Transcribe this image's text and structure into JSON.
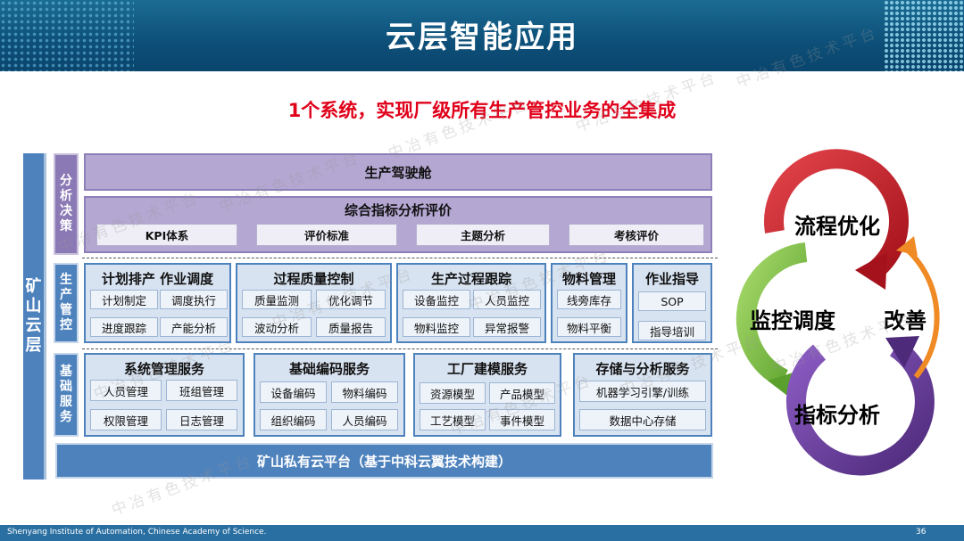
{
  "header": {
    "title": "云层智能应用"
  },
  "subtitle": "1个系统，实现厂级所有生产管控业务的全集成",
  "sidebar": {
    "label": "矿山云层"
  },
  "sections": {
    "analysis": {
      "label": "分析决策",
      "cockpit": "生产驾驶舱",
      "evaluation": {
        "title": "综合指标分析评价",
        "items": [
          "KPI体系",
          "评价标准",
          "主题分析",
          "考核评价"
        ]
      }
    },
    "control": {
      "label": "生产管控",
      "cards": [
        {
          "title": "计划排产 作业调度",
          "items": [
            "计划制定",
            "调度执行",
            "进度跟踪",
            "产能分析"
          ]
        },
        {
          "title": "过程质量控制",
          "items": [
            "质量监测",
            "优化调节",
            "波动分析",
            "质量报告"
          ]
        },
        {
          "title": "生产过程跟踪",
          "items": [
            "设备监控",
            "人员监控",
            "物料监控",
            "异常报警"
          ]
        },
        {
          "title": "物料管理",
          "items": [
            "线旁库存",
            "物料平衡"
          ]
        },
        {
          "title": "作业指导",
          "items": [
            "SOP",
            "指导培训"
          ]
        }
      ]
    },
    "base": {
      "label": "基础服务",
      "cards": [
        {
          "title": "系统管理服务",
          "items": [
            "人员管理",
            "班组管理",
            "权限管理",
            "日志管理"
          ]
        },
        {
          "title": "基础编码服务",
          "items": [
            "设备编码",
            "物料编码",
            "组织编码",
            "人员编码"
          ]
        },
        {
          "title": "工厂建模服务",
          "items": [
            "资源模型",
            "产品模型",
            "工艺模型",
            "事件模型"
          ]
        },
        {
          "title": "存储与分析服务",
          "items": [
            "机器学习引擎/训练",
            "数据中心存储"
          ]
        }
      ]
    }
  },
  "platform": "矿山私有云平台（基于中科云翼技术构建）",
  "cycle": {
    "labels": {
      "top": "流程优化",
      "left": "监控调度",
      "right": "改善",
      "bottom": "指标分析"
    },
    "colors": {
      "red": "#c8202a",
      "green": "#7cc142",
      "purple": "#6a3e9a",
      "orange": "#f08a24"
    }
  },
  "watermark": "中冶有色技术平台",
  "footer": {
    "institution": "Shenyang Institute of Automation, Chinese Academy of Science.",
    "page": "36"
  }
}
